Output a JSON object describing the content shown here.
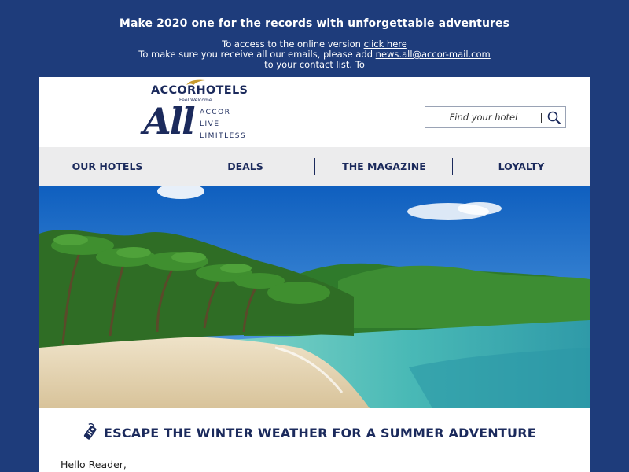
{
  "preheader": {
    "headline": "Make 2020 one for the records with unforgettable adventures",
    "online_prefix": "To access to the online version",
    "online_link": "click here",
    "emails_prefix": "To make sure you receive all our emails, please add",
    "email_address": "news.all@accor-mail.com",
    "contact_line": "to your contact list. To"
  },
  "brand": {
    "accorhotels": "ACCORHOTELS",
    "tagline": "Feel Welcome",
    "all_logo": "All",
    "all_sub": [
      "ACCOR",
      "LIVE",
      "LIMITLESS"
    ]
  },
  "search": {
    "placeholder": "Find your hotel",
    "icon": "search-icon"
  },
  "nav": {
    "items": [
      "OUR HOTELS",
      "DEALS",
      "THE MAGAZINE",
      "LOYALTY"
    ]
  },
  "hero": {
    "image": "tropical-beach-photo"
  },
  "content": {
    "section_icon": "luggage-tag-icon",
    "section_title": "ESCAPE THE WINTER WEATHER FOR A SUMMER ADVENTURE",
    "greeting": "Hello Reader,"
  },
  "colors": {
    "background": "#1e3c7b",
    "brand_navy": "#1b2a5c",
    "nav_bg": "#ececed",
    "accent_gold": "#c79a2e"
  }
}
